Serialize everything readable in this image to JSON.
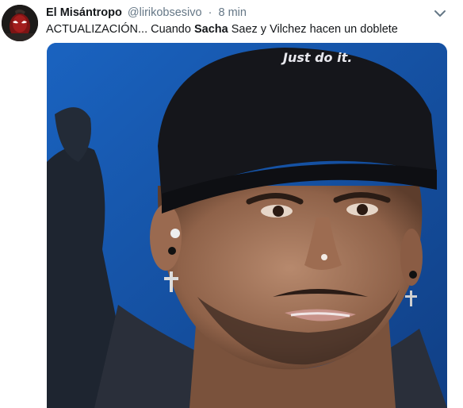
{
  "tweet": {
    "display_name": "El Misántropo",
    "username": "@lirikobsesivo",
    "separator": "·",
    "timestamp": "8 min",
    "text_before": "ACTUALIZACIÓN... Cuando ",
    "text_bold": "Sacha",
    "text_after": " Saez y Vilchez hacen un doblete"
  },
  "media": {
    "cap_text": "Just do it."
  },
  "icons": {
    "avatar": "avatar-image",
    "caret": "chevron-down-icon"
  },
  "colors": {
    "text": "#14171a",
    "secondary": "#657786",
    "media_background": "#1b5fb5"
  }
}
